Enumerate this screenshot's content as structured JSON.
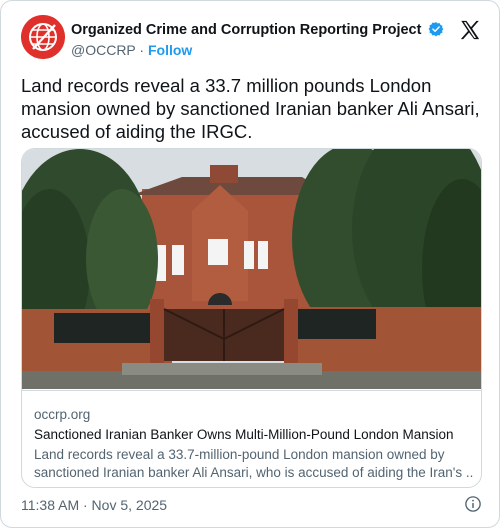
{
  "account": {
    "name": "Organized Crime and Corruption Reporting Project",
    "handle": "@OCCRP",
    "separator": "·",
    "follow_label": "Follow",
    "verified_icon": "verified-badge-icon",
    "avatar_icon": "occrp-globe-logo"
  },
  "tweet": {
    "text": "Land records reveal a 33.7 million pounds London mansion owned by sanctioned Iranian banker Ali Ansari, accused of aiding the IRGC."
  },
  "link_card": {
    "domain": "occrp.org",
    "title": "Sanctioned Iranian Banker Owns Multi-Million-Pound London Mansion",
    "description_line1": "Land records reveal a 33.7-million-pound London mansion owned by",
    "description_line2": "sanctioned Iranian banker Ali Ansari, who is accused of aiding the Iran's ..."
  },
  "footer": {
    "timestamp": "11:38 AM · Nov 5, 2025",
    "info_icon": "info-icon"
  },
  "colors": {
    "accent": "#1d9bf0",
    "text": "#0f1419",
    "muted": "#536471",
    "border": "#cfd9de",
    "brand": "#e0302b"
  }
}
